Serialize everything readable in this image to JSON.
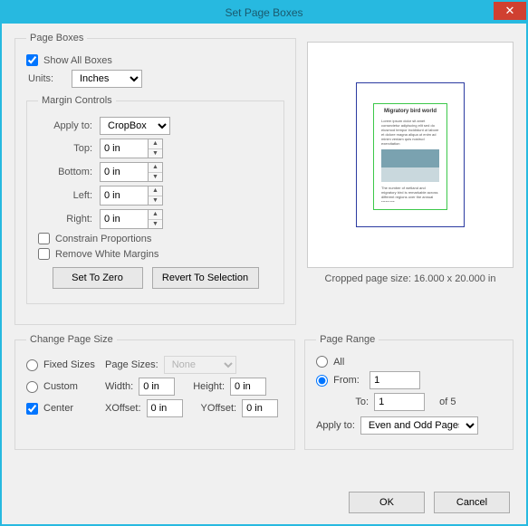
{
  "title": "Set Page Boxes",
  "close_glyph": "✕",
  "pageBoxes": {
    "legend": "Page Boxes",
    "showAll": "Show All Boxes",
    "unitsLabel": "Units:",
    "unitsValue": "Inches",
    "margin": {
      "legend": "Margin Controls",
      "applyLabel": "Apply to:",
      "applyValue": "CropBox",
      "topLabel": "Top:",
      "bottomLabel": "Bottom:",
      "leftLabel": "Left:",
      "rightLabel": "Right:",
      "zeroIn": "0 in",
      "constrain": "Constrain Proportions",
      "removeWhite": "Remove White Margins",
      "setZero": "Set To Zero",
      "revert": "Revert To Selection"
    }
  },
  "preview": {
    "caption": "Cropped page size: 16.000 x 20.000 in"
  },
  "changeSize": {
    "legend": "Change Page Size",
    "fixed": "Fixed Sizes",
    "pageSizesLabel": "Page Sizes:",
    "pageSizesValue": "None",
    "custom": "Custom",
    "widthLabel": "Width:",
    "heightLabel": "Height:",
    "center": "Center",
    "xoffLabel": "XOffset:",
    "yoffLabel": "YOffset:",
    "zeroIn": "0 in"
  },
  "pageRange": {
    "legend": "Page Range",
    "all": "All",
    "fromLabel": "From:",
    "fromVal": "1",
    "toLabel": "To:",
    "toVal": "1",
    "ofText": "of 5",
    "applyLabel": "Apply to:",
    "applyValue": "Even and Odd Pages"
  },
  "buttons": {
    "ok": "OK",
    "cancel": "Cancel"
  }
}
